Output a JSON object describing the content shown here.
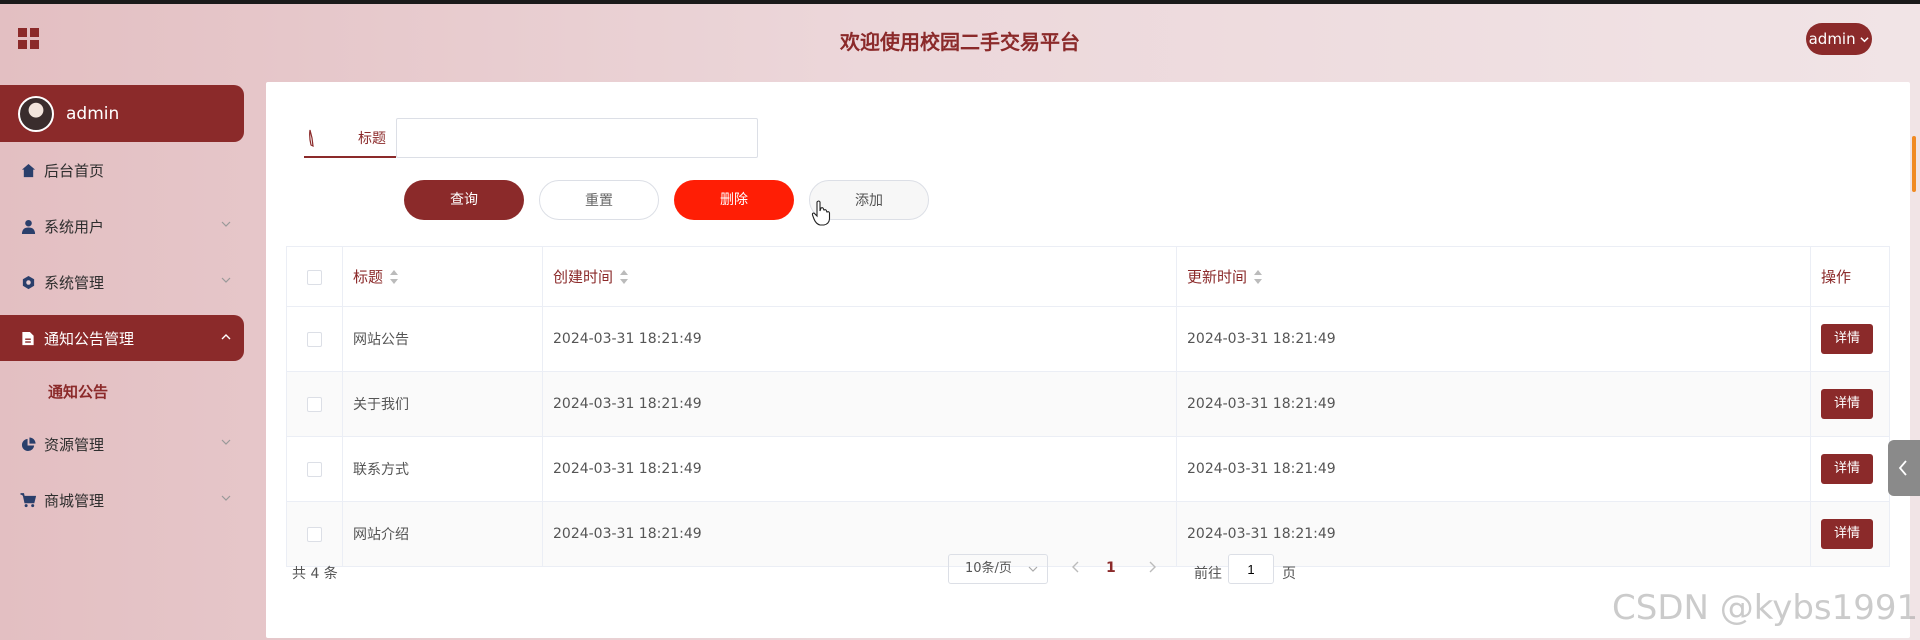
{
  "header": {
    "title": "欢迎使用校园二手交易平台",
    "user_menu": "admin"
  },
  "sidebar": {
    "profile_name": "admin",
    "items": [
      {
        "label": "后台首页",
        "icon": "home-icon"
      },
      {
        "label": "系统用户",
        "icon": "user-icon"
      },
      {
        "label": "系统管理",
        "icon": "settings-icon"
      },
      {
        "label": "通知公告管理",
        "icon": "document-icon"
      },
      {
        "label": "资源管理",
        "icon": "pie-chart-icon"
      },
      {
        "label": "商城管理",
        "icon": "cart-icon"
      }
    ],
    "submenu": {
      "label": "通知公告"
    }
  },
  "search": {
    "label": "标题",
    "value": ""
  },
  "actions": {
    "query": "查询",
    "reset": "重置",
    "delete": "删除",
    "add": "添加"
  },
  "table": {
    "headers": {
      "title": "标题",
      "created": "创建时间",
      "updated": "更新时间",
      "operation": "操作"
    },
    "rows": [
      {
        "title": "网站公告",
        "created": "2024-03-31 18:21:49",
        "updated": "2024-03-31 18:21:49",
        "action": "详情"
      },
      {
        "title": "关于我们",
        "created": "2024-03-31 18:21:49",
        "updated": "2024-03-31 18:21:49",
        "action": "详情"
      },
      {
        "title": "联系方式",
        "created": "2024-03-31 18:21:49",
        "updated": "2024-03-31 18:21:49",
        "action": "详情"
      },
      {
        "title": "网站介绍",
        "created": "2024-03-31 18:21:49",
        "updated": "2024-03-31 18:21:49",
        "action": "详情"
      }
    ]
  },
  "pagination": {
    "total": "共 4 条",
    "page_size": "10条/页",
    "current": "1",
    "goto_prefix": "前往",
    "goto_value": "1",
    "goto_suffix": "页"
  },
  "watermark": "CSDN @kybs1991",
  "colors": {
    "primary": "#8b2a2a",
    "danger": "#ff1e05",
    "scrollbar": "#f08a24"
  }
}
